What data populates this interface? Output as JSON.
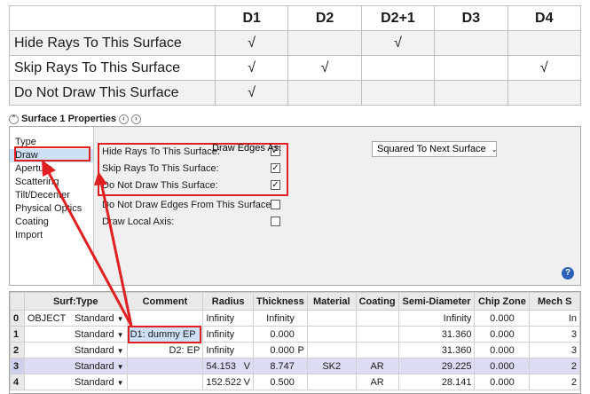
{
  "comparison": {
    "columns": [
      "D1",
      "D2",
      "D2+1",
      "D3",
      "D4"
    ],
    "rows": [
      {
        "label": "Hide Rays To This Surface",
        "marks": [
          "√",
          "",
          "√",
          "",
          ""
        ]
      },
      {
        "label": "Skip Rays To This Surface",
        "marks": [
          "√",
          "√",
          "",
          "",
          "√"
        ]
      },
      {
        "label": "Do Not Draw This Surface",
        "marks": [
          "√",
          "",
          "",
          "",
          ""
        ]
      }
    ]
  },
  "properties": {
    "title": "Surface 1 Properties",
    "collapse_icon": "chevron-up-circle-icon",
    "prev_icon": "chevron-left-circle-icon",
    "next_icon": "chevron-right-circle-icon",
    "nav": [
      "Type",
      "Draw",
      "Aperture",
      "Scattering",
      "Tilt/Decenter",
      "Physical Optics",
      "Coating",
      "Import"
    ],
    "nav_selected": "Draw",
    "options": [
      {
        "label": "Hide Rays To This Surface:",
        "checked": true
      },
      {
        "label": "Skip Rays To This Surface:",
        "checked": true
      },
      {
        "label": "Do Not Draw This Surface:",
        "checked": true
      },
      {
        "label": "Do Not Draw Edges From This Surface:",
        "checked": false
      },
      {
        "label": "Draw Local Axis:",
        "checked": false
      }
    ],
    "draw_edges_label": "Draw Edges As:",
    "draw_edges_value": "Squared To Next Surface",
    "help_icon": "help-icon",
    "check_glyph": "✓",
    "dropdown_glyph": "⌄"
  },
  "grid": {
    "headers": [
      "",
      "Surf:Type",
      "Comment",
      "Radius",
      "Thickness",
      "Material",
      "Coating",
      "Semi-Diameter",
      "Chip Zone",
      "Mech S"
    ],
    "rows": [
      {
        "idx": "0",
        "surf_prefix": "OBJECT",
        "type": "Standard",
        "comment": "",
        "radius": "Infinity",
        "radius_flag": "",
        "thickness": "Infinity",
        "thickness_flag": "",
        "material": "",
        "coating": "",
        "semi": "Infinity",
        "chip": "0.000",
        "mech": "In"
      },
      {
        "idx": "1",
        "surf_prefix": "",
        "type": "Standard",
        "comment": "D1: dummy EP",
        "radius": "Infinity",
        "radius_flag": "",
        "thickness": "0.000",
        "thickness_flag": "",
        "material": "",
        "coating": "",
        "semi": "31.360",
        "chip": "0.000",
        "mech": "3"
      },
      {
        "idx": "2",
        "surf_prefix": "",
        "type": "Standard",
        "comment": "D2: EP",
        "radius": "Infinity",
        "radius_flag": "",
        "thickness": "0.000",
        "thickness_flag": "P",
        "material": "",
        "coating": "",
        "semi": "31.360",
        "chip": "0.000",
        "mech": "3"
      },
      {
        "idx": "3",
        "surf_prefix": "",
        "type": "Standard",
        "comment": "",
        "radius": "54.153",
        "radius_flag": "V",
        "thickness": "8.747",
        "thickness_flag": "",
        "material": "SK2",
        "coating": "AR",
        "semi": "29.225",
        "chip": "0.000",
        "mech": "2"
      },
      {
        "idx": "4",
        "surf_prefix": "",
        "type": "Standard",
        "comment": "",
        "radius": "152.522",
        "radius_flag": "V",
        "thickness": "0.500",
        "thickness_flag": "",
        "material": "",
        "coating": "AR",
        "semi": "28.141",
        "chip": "0.000",
        "mech": "2"
      }
    ],
    "highlight_row": "3"
  },
  "colors": {
    "annotation_red": "#e02020",
    "selection_blue": "#cde0f5",
    "row_highlight": "#dcdcf5"
  }
}
